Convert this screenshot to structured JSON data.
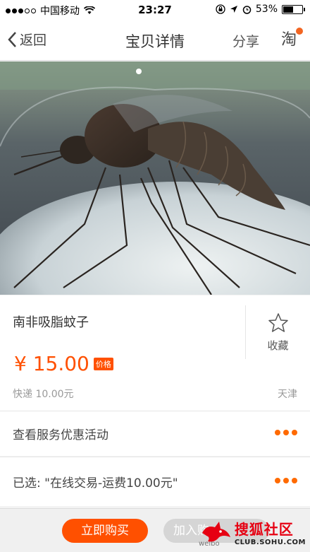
{
  "status_bar": {
    "carrier": "中国移动",
    "time": "23:27",
    "battery": "53%",
    "battery_level": 0.53
  },
  "nav": {
    "back_label": "返回",
    "title": "宝贝详情",
    "share_label": "分享",
    "tao_label": "淘"
  },
  "product": {
    "title": "南非吸脂蚊子",
    "favorite_label": "收藏",
    "price": "¥ 15.00",
    "price_tag": "价格",
    "shipping": "快递 10.00元",
    "location": "天津",
    "image_page_current": 1
  },
  "rows": {
    "service": "查看服务优惠活动",
    "selected": "已选: \"在线交易-运费10.00元\""
  },
  "bottom": {
    "buy_label": "立即购买",
    "cart_label": "加入购"
  },
  "watermark": {
    "brand": "搜狐社区",
    "site": "CLUB.SOHU.COM",
    "weibo": "weibo"
  },
  "colors": {
    "accent": "#ff5000",
    "dots": "#ff6a00",
    "badge": "#f26522"
  }
}
